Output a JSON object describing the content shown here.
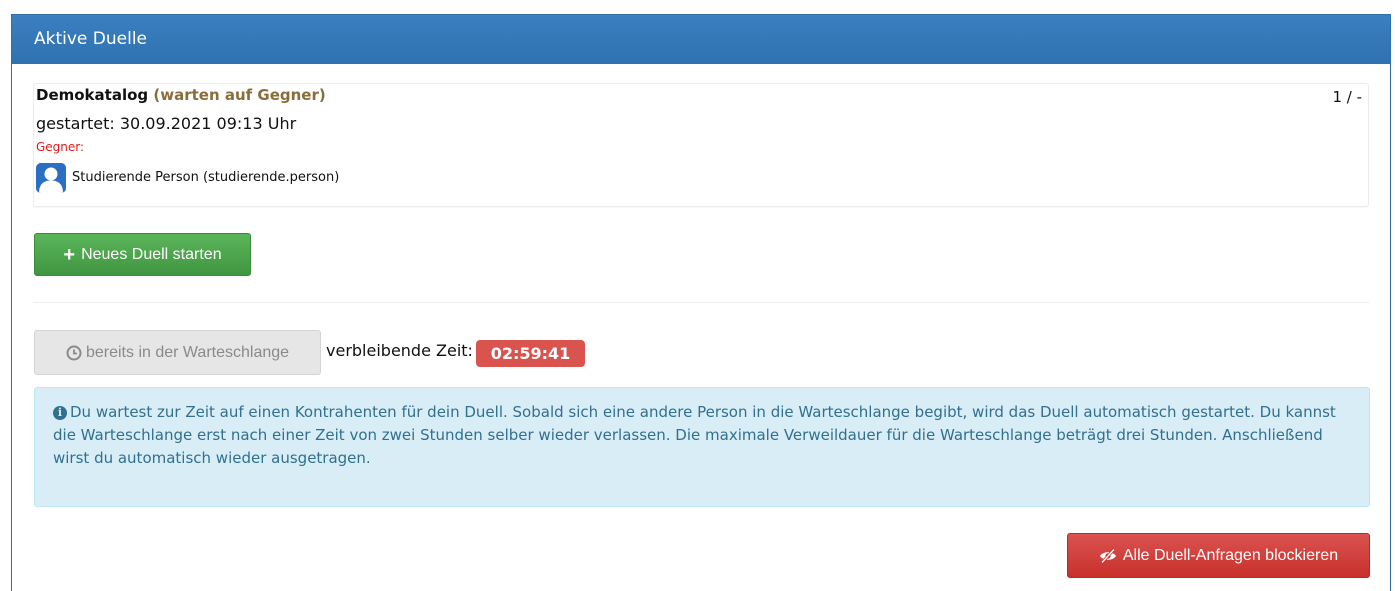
{
  "panel": {
    "heading": "Aktive Duelle"
  },
  "duel": {
    "catalog": "Demokatalog",
    "status": "(warten auf Gegner)",
    "pager": "1 / -",
    "started": "gestartet: 30.09.2021 09:13 Uhr",
    "opponent_label": "Gegner:",
    "opponent_name": "Studierende Person (studierende.person)",
    "avatar_icon": "user-avatar-icon"
  },
  "actions": {
    "new_duel_label": "Neues Duell starten",
    "new_duel_icon": "plus-icon",
    "queue_label": "bereits in der Warteschlange",
    "queue_icon": "clock-icon",
    "remaining_label": "verbleibende Zeit:",
    "remaining_time": "02:59:41",
    "block_label": "Alle Duell-Anfragen blockieren",
    "block_icon": "eye-slash-icon"
  },
  "info": {
    "icon": "info-icon",
    "text": "Du wartest zur Zeit auf einen Kontrahenten für dein Duell. Sobald sich eine andere Person in die Warteschlange begibt, wird das Duell automatisch gestartet. Du kannst die Warteschlange erst nach einer Zeit von zwei Stunden selber wieder verlassen. Die maximale Verweildauer für die Warteschlange beträgt drei Stunden. Anschließend wirst du automatisch wieder ausgetragen."
  },
  "colors": {
    "heading_bg": "#337ab7",
    "success": "#4cae4c",
    "danger": "#d9534f",
    "info_bg": "#d9edf7",
    "info_text": "#31708f",
    "status_text": "#8a6d3b",
    "opponent_label": "#e31a1a"
  }
}
